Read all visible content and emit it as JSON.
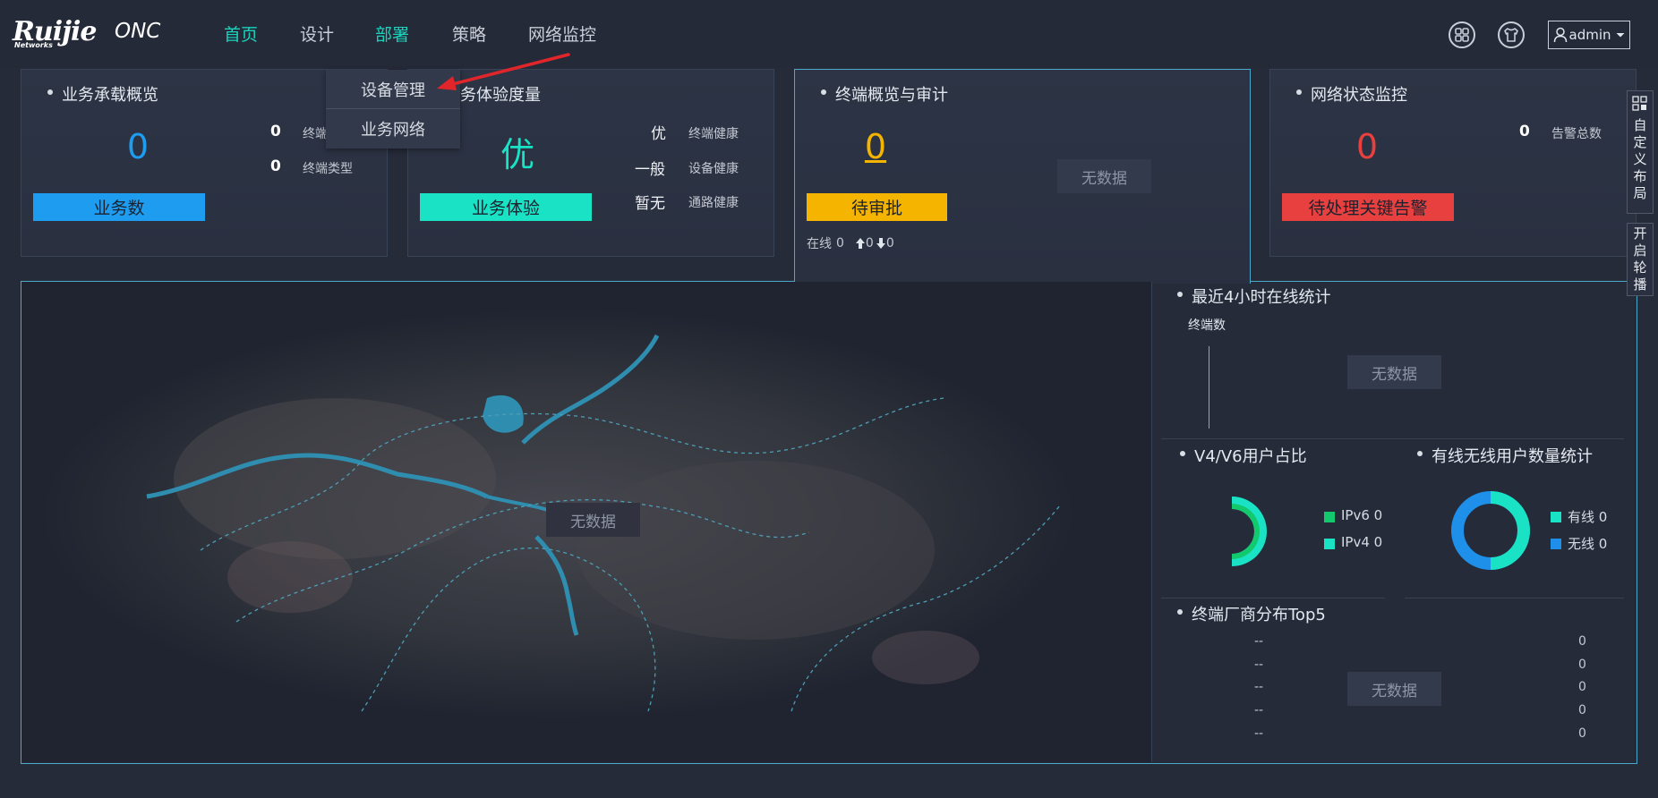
{
  "logo": {
    "brand": "Ruijie",
    "sub": "Networks",
    "product": "ONC"
  },
  "nav": [
    {
      "label": "首页",
      "active": true
    },
    {
      "label": "设计",
      "active": false
    },
    {
      "label": "部署",
      "active": true
    },
    {
      "label": "策略",
      "active": false
    },
    {
      "label": "网络监控",
      "active": false
    }
  ],
  "header": {
    "user": "admin",
    "icons": [
      "apps-grid-icon",
      "shirt-icon",
      "user-icon",
      "caret-down-icon"
    ]
  },
  "dropdown": {
    "items": [
      "设备管理",
      "业务网络"
    ]
  },
  "cards": {
    "business_load": {
      "title": "业务承载概览",
      "count": "0",
      "count_label": "业务数",
      "stats": [
        {
          "value": "0",
          "label": "终端"
        },
        {
          "value": "0",
          "label": "终端类型"
        }
      ]
    },
    "experience": {
      "title": "务体验度量",
      "grade": "优",
      "grade_label": "业务体验",
      "stats": [
        {
          "value": "优",
          "label": "终端健康"
        },
        {
          "value": "一般",
          "label": "设备健康"
        },
        {
          "value": "暂无",
          "label": "通路健康"
        }
      ]
    },
    "terminal_audit": {
      "title": "终端概览与审计",
      "pending": "0",
      "pending_label": "待审批",
      "online_label": "在线",
      "online": "0",
      "up": "0",
      "down": "0",
      "no_data": "无数据"
    },
    "network_monitor": {
      "title": "网络状态监控",
      "alerts": "0",
      "alerts_label": "待处理关键告警",
      "total_value": "0",
      "total_label": "告警总数"
    }
  },
  "map": {
    "no_data": "无数据"
  },
  "online_stats": {
    "title": "最近4小时在线统计",
    "axis_label": "终端数",
    "no_data": "无数据"
  },
  "v4v6": {
    "title": "V4/V6用户占比",
    "legend": [
      {
        "label": "IPv6 0",
        "color": "#13c96e"
      },
      {
        "label": "IPv4 0",
        "color": "#19e3c4"
      }
    ]
  },
  "wired": {
    "title": "有线无线用户数量统计",
    "legend": [
      {
        "label": "有线 0",
        "color": "#19e3c4"
      },
      {
        "label": "无线 0",
        "color": "#1e90ea"
      }
    ]
  },
  "vendor": {
    "title": "终端厂商分布Top5",
    "rows": [
      {
        "name": "--",
        "value": "0"
      },
      {
        "name": "--",
        "value": "0"
      },
      {
        "name": "--",
        "value": "0"
      },
      {
        "name": "--",
        "value": "0"
      },
      {
        "name": "--",
        "value": "0"
      }
    ],
    "no_data": "无数据"
  },
  "side_tabs": {
    "custom_layout": "自定义布局",
    "carousel": "开启轮播"
  },
  "colors": {
    "accent": "#19d4bd",
    "blue": "#1e9cf0",
    "teal": "#19e3c4",
    "orange": "#f5b400",
    "red": "#e8403e"
  }
}
